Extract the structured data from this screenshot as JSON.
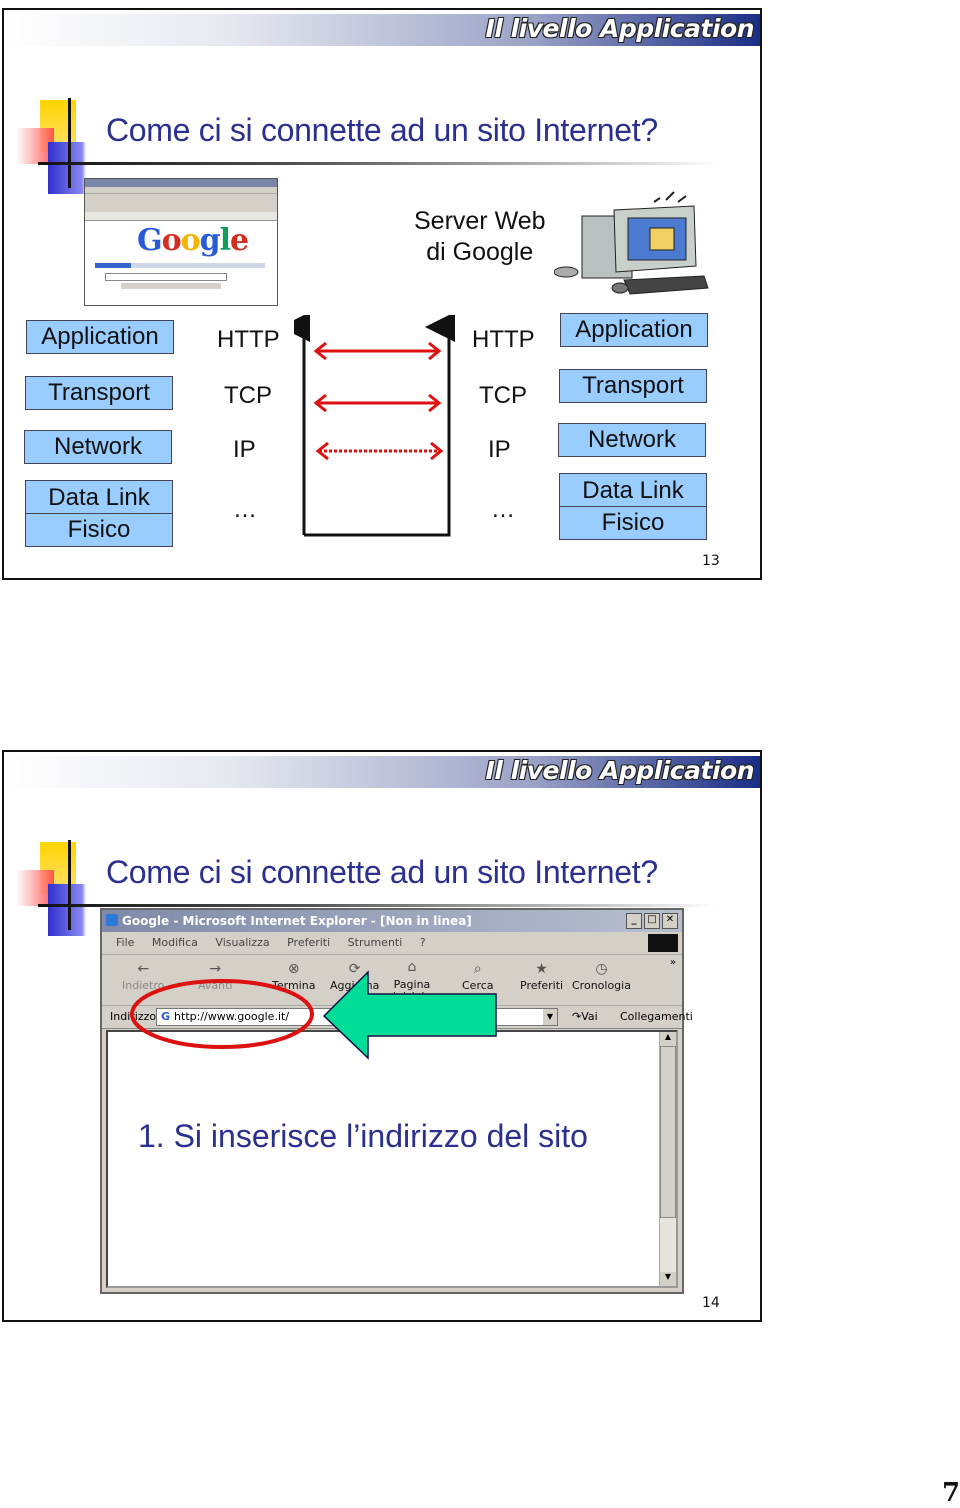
{
  "slides": [
    {
      "header": "Il livello Application",
      "title": "Come ci si connette ad un sito Internet?",
      "server_label": [
        "Server Web",
        "di Google"
      ],
      "client_stack": [
        "Application",
        "Transport",
        "Network",
        "Data Link",
        "Fisico"
      ],
      "server_stack": [
        "Application",
        "Transport",
        "Network",
        "Data Link",
        "Fisico"
      ],
      "protocols": [
        "HTTP",
        "TCP",
        "IP",
        "…"
      ],
      "mini_browser_logo": "Google",
      "page_number": "13",
      "icons": [
        "browser-screenshot-icon",
        "server-computer-icon"
      ]
    },
    {
      "header": "Il livello Application",
      "title": "Come ci si connette ad un sito Internet?",
      "browser": {
        "window_title": "Google - Microsoft Internet Explorer - [Non in linea]",
        "menu": [
          "File",
          "Modifica",
          "Visualizza",
          "Preferiti",
          "Strumenti",
          "?"
        ],
        "toolbar": [
          "Indietro",
          "Avanti",
          "Termina",
          "Aggiorna",
          "Pagina iniziale",
          "Cerca",
          "Preferiti",
          "Cronologia"
        ],
        "address_label": "Indirizzo",
        "address_value": "http://www.google.it/",
        "go_label": "Vai",
        "links_label": "Collegamenti"
      },
      "step_text": "1. Si inserisce l’indirizzo del sito",
      "page_number": "14",
      "colors": {
        "highlight_ellipse": "#dd1111",
        "arrow": "#00dd99"
      }
    }
  ],
  "document_page_number": "7"
}
